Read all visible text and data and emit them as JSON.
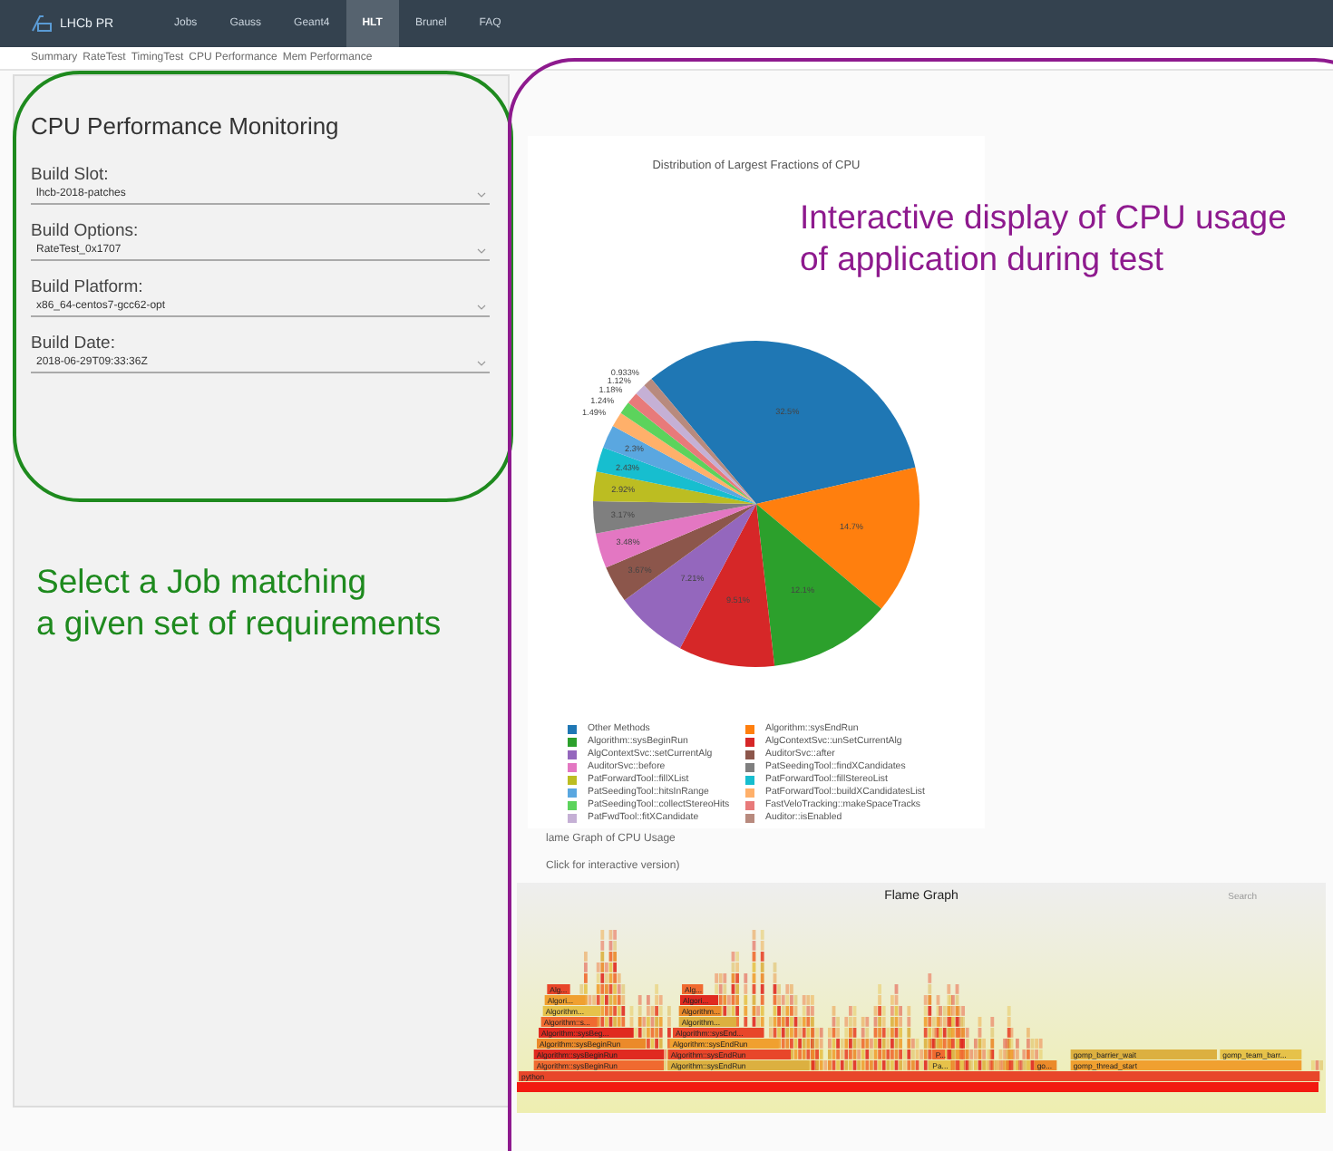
{
  "nav": {
    "brand": "LHCb PR",
    "tabs": [
      {
        "label": "Jobs",
        "selected": false
      },
      {
        "label": "Gauss",
        "selected": false
      },
      {
        "label": "Geant4",
        "selected": false
      },
      {
        "label": "HLT",
        "selected": true
      },
      {
        "label": "Brunel",
        "selected": false
      },
      {
        "label": "FAQ",
        "selected": false
      }
    ]
  },
  "subnav": [
    "Summary",
    "RateTest",
    "TimingTest",
    "CPU Performance",
    "Mem Performance"
  ],
  "job_form": {
    "title": "CPU Performance Monitoring",
    "fields": [
      {
        "label": "Build Slot:",
        "value": "lhcb-2018-patches"
      },
      {
        "label": "Build Options:",
        "value": "RateTest_0x1707"
      },
      {
        "label": "Build Platform:",
        "value": "x86_64-centos7-gcc62-opt"
      },
      {
        "label": "Build Date:",
        "value": "2018-06-29T09:33:36Z"
      }
    ]
  },
  "cpu_chart": {
    "chart_data": {
      "type": "pie",
      "title": "Distribution of Largest Fractions of CPU",
      "categories": [
        "Other Methods",
        "Algorithm::sysEndRun",
        "Algorithm::sysBeginRun",
        "AlgContextSvc::unSetCurrentAlg",
        "AlgContextSvc::setCurrentAlg",
        "AuditorSvc::after",
        "AuditorSvc::before",
        "PatSeedingTool::findXCandidates",
        "PatForwardTool::fillXList",
        "PatForwardTool::fillStereoList",
        "PatSeedingTool::hitsInRange",
        "PatForwardTool::buildXCandidatesList",
        "PatSeedingTool::collectStereoHits",
        "FastVeloTracking::makeSpaceTracks",
        "PatFwdTool::fitXCandidate",
        "Auditor::isEnabled"
      ],
      "values": [
        32.5,
        14.7,
        12.1,
        9.51,
        7.21,
        3.67,
        3.48,
        3.17,
        2.92,
        2.43,
        2.3,
        1.49,
        1.24,
        1.18,
        1.12,
        0.933
      ],
      "value_labels": [
        "32.5%",
        "14.7%",
        "12.1%",
        "9.51%",
        "7.21%",
        "3.67%",
        "3.48%",
        "3.17%",
        "2.92%",
        "2.43%",
        "2.3%",
        "1.49%",
        "1.24%",
        "1.18%",
        "1.12%",
        "0.933%"
      ],
      "colors": [
        "#1f77b4",
        "#ff7f0e",
        "#2ca02c",
        "#d62728",
        "#9467bd",
        "#8c564b",
        "#e377c2",
        "#7f7f7f",
        "#bcbd22",
        "#17becf",
        "#5aa7e0",
        "#ffb06a",
        "#5cd35c",
        "#e87a7a",
        "#c5b0d5",
        "#b88a7e"
      ]
    }
  },
  "flame_graph": {
    "caption": "lame Graph of CPU Usage",
    "link": "Click for interactive version)",
    "title": "Flame Graph",
    "search": "Search",
    "frames": [
      {
        "label": "python"
      },
      {
        "label": "Algorithm::sysBeginRun"
      },
      {
        "label": "Algorithm::sysEndRun"
      },
      {
        "label": "Pa..."
      },
      {
        "label": "go..."
      },
      {
        "label": "gomp_thread_start"
      },
      {
        "label": "Algorithm::sysBeginRun"
      },
      {
        "label": "Algorithm::sysEndRun"
      },
      {
        "label": "P..."
      },
      {
        "label": "gomp_barrier_wait"
      },
      {
        "label": "gomp_team_barr..."
      },
      {
        "label": "Algorithm::sysBeginRun"
      },
      {
        "label": "Algorithm::sysEndRun"
      },
      {
        "label": "Algorithm::sysBeg..."
      },
      {
        "label": "Algorithm::sysEnd..."
      },
      {
        "label": "Algorithm::s..."
      },
      {
        "label": "Algorithm..."
      },
      {
        "label": "Algorithm..."
      },
      {
        "label": "Algorithm..."
      },
      {
        "label": "Algori..."
      },
      {
        "label": "Algori..."
      },
      {
        "label": "Alg..."
      },
      {
        "label": "Alg..."
      }
    ]
  },
  "annotations": [
    {
      "kind": "job",
      "lines": [
        "Select a Job matching",
        "a given set of requirements"
      ]
    },
    {
      "kind": "cpu",
      "lines": [
        "Interactive display of CPU usage",
        "of application during test"
      ]
    }
  ]
}
